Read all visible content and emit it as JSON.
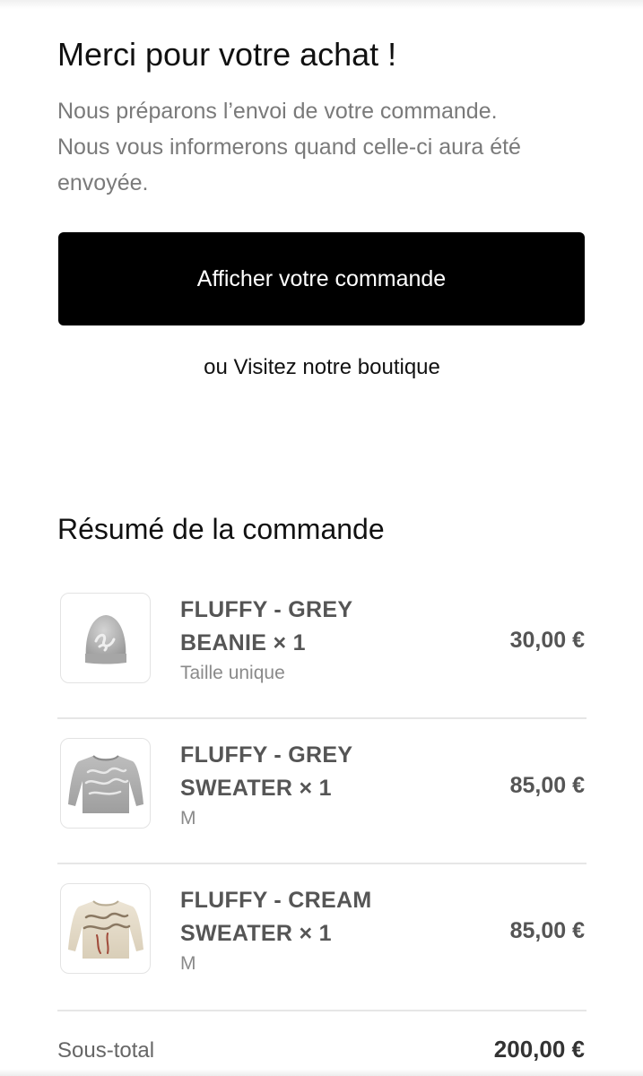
{
  "header": {
    "title": "Merci pour votre achat !",
    "message_line1": "Nous préparons l’envoi de votre commande.",
    "message_line2": "Nous vous informerons quand celle-ci aura été envoyée."
  },
  "actions": {
    "view_order_label": "Afficher votre commande",
    "visit_shop_label": "ou Visitez notre boutique"
  },
  "summary": {
    "heading": "Résumé de la commande",
    "items": [
      {
        "name_line1": "FLUFFY - GREY",
        "name_line2": "BEANIE × 1",
        "variant": "Taille unique",
        "price": "30,00 €",
        "icon": "beanie-image"
      },
      {
        "name_line1": "FLUFFY - GREY",
        "name_line2": "SWEATER × 1",
        "variant": "M",
        "price": "85,00 €",
        "icon": "grey-sweater-image"
      },
      {
        "name_line1": "FLUFFY - CREAM",
        "name_line2": "SWEATER × 1",
        "variant": "M",
        "price": "85,00 €",
        "icon": "cream-sweater-image"
      }
    ],
    "subtotal_label": "Sous-total",
    "subtotal_value": "200,00 €"
  },
  "colors": {
    "button_bg": "#000000",
    "muted_text": "#7a7a7a",
    "item_text": "#555555",
    "divider": "#e6e6e6"
  }
}
